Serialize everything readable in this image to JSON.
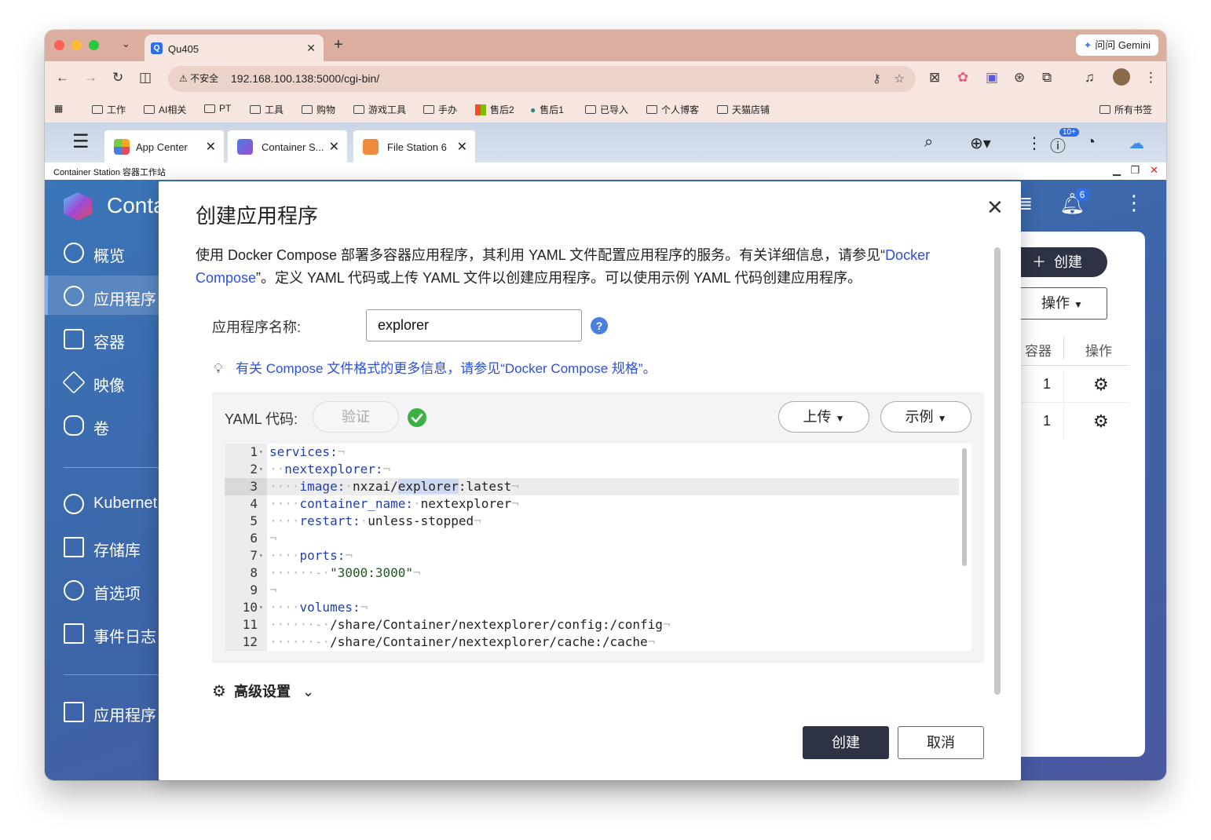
{
  "browser": {
    "tab_title": "Qu405",
    "tab_favicon": "Q",
    "gemini_label": "问问 Gemini",
    "security_label": "不安全",
    "url": "192.168.100.138:5000/cgi-bin/",
    "bookmarks": [
      "工作",
      "AI相关",
      "PT",
      "工具",
      "购物",
      "游戏工具",
      "手办",
      "售后2",
      "售后1",
      "已导入",
      "个人博客",
      "天猫店铺"
    ],
    "all_bookmarks": "所有书签"
  },
  "qts": {
    "tabs": [
      {
        "label": "App Center"
      },
      {
        "label": "Container S..."
      },
      {
        "label": "File Station 6"
      }
    ],
    "badge": "10+"
  },
  "app": {
    "window_title": "Container Station 容器工作站",
    "brand": "Conta",
    "bell_badge": "6",
    "sidebar": [
      {
        "label": "概览"
      },
      {
        "label": "应用程序"
      },
      {
        "label": "容器"
      },
      {
        "label": "映像"
      },
      {
        "label": "卷"
      },
      {
        "label": "Kubernet"
      },
      {
        "label": "存储库"
      },
      {
        "label": "首选项"
      },
      {
        "label": "事件日志"
      },
      {
        "label": "应用程序"
      }
    ],
    "create_button": "创建",
    "action_button": "操作",
    "table": {
      "headers": [
        "容器",
        "操作"
      ],
      "rows": [
        {
          "containers": "1"
        },
        {
          "containers": "1"
        }
      ]
    }
  },
  "modal": {
    "title": "创建应用程序",
    "desc_part1": "使用 Docker Compose 部署多容器应用程序，其利用 YAML 文件配置应用程序的服务。有关详细信息，请参见“",
    "desc_link": "Docker Compose",
    "desc_part2": "”。定义 YAML 代码或上传 YAML 文件以创建应用程序。可以使用示例 YAML 代码创建应用程序。",
    "name_label": "应用程序名称:",
    "name_value": "explorer",
    "help_icon": "?",
    "tip_text": "有关 Compose 文件格式的更多信息，请参见“Docker Compose 规格”。",
    "yaml_label": "YAML 代码:",
    "validate": "验证",
    "upload": "上传",
    "example": "示例",
    "code_lines": [
      {
        "n": "1",
        "fold": true,
        "indent": "",
        "key": "services:",
        "val": ""
      },
      {
        "n": "2",
        "fold": true,
        "indent": "··",
        "key": "nextexplorer:",
        "val": ""
      },
      {
        "n": "3",
        "fold": false,
        "indent": "····",
        "key": "image:",
        "val": "nxzai/explorer:latest"
      },
      {
        "n": "4",
        "fold": false,
        "indent": "····",
        "key": "container_name:",
        "val": "nextexplorer"
      },
      {
        "n": "5",
        "fold": false,
        "indent": "····",
        "key": "restart:",
        "val": "unless-stopped"
      },
      {
        "n": "6",
        "fold": false,
        "indent": "",
        "key": "",
        "val": ""
      },
      {
        "n": "7",
        "fold": true,
        "indent": "····",
        "key": "ports:",
        "val": ""
      },
      {
        "n": "8",
        "fold": false,
        "indent": "······-·",
        "key": "",
        "val": "\"3000:3000\""
      },
      {
        "n": "9",
        "fold": false,
        "indent": "",
        "key": "",
        "val": ""
      },
      {
        "n": "10",
        "fold": true,
        "indent": "····",
        "key": "volumes:",
        "val": ""
      },
      {
        "n": "11",
        "fold": false,
        "indent": "······-·",
        "key": "",
        "val": "/share/Container/nextexplorer/config:/config"
      },
      {
        "n": "12",
        "fold": false,
        "indent": "······-·",
        "key": "",
        "val": "/share/Container/nextexplorer/cache:/cache"
      }
    ],
    "advanced": "高级设置",
    "create": "创建",
    "cancel": "取消"
  },
  "colors": {
    "accent": "#2c4fd6",
    "primary_button": "#2d3345",
    "success": "#3cb043"
  }
}
